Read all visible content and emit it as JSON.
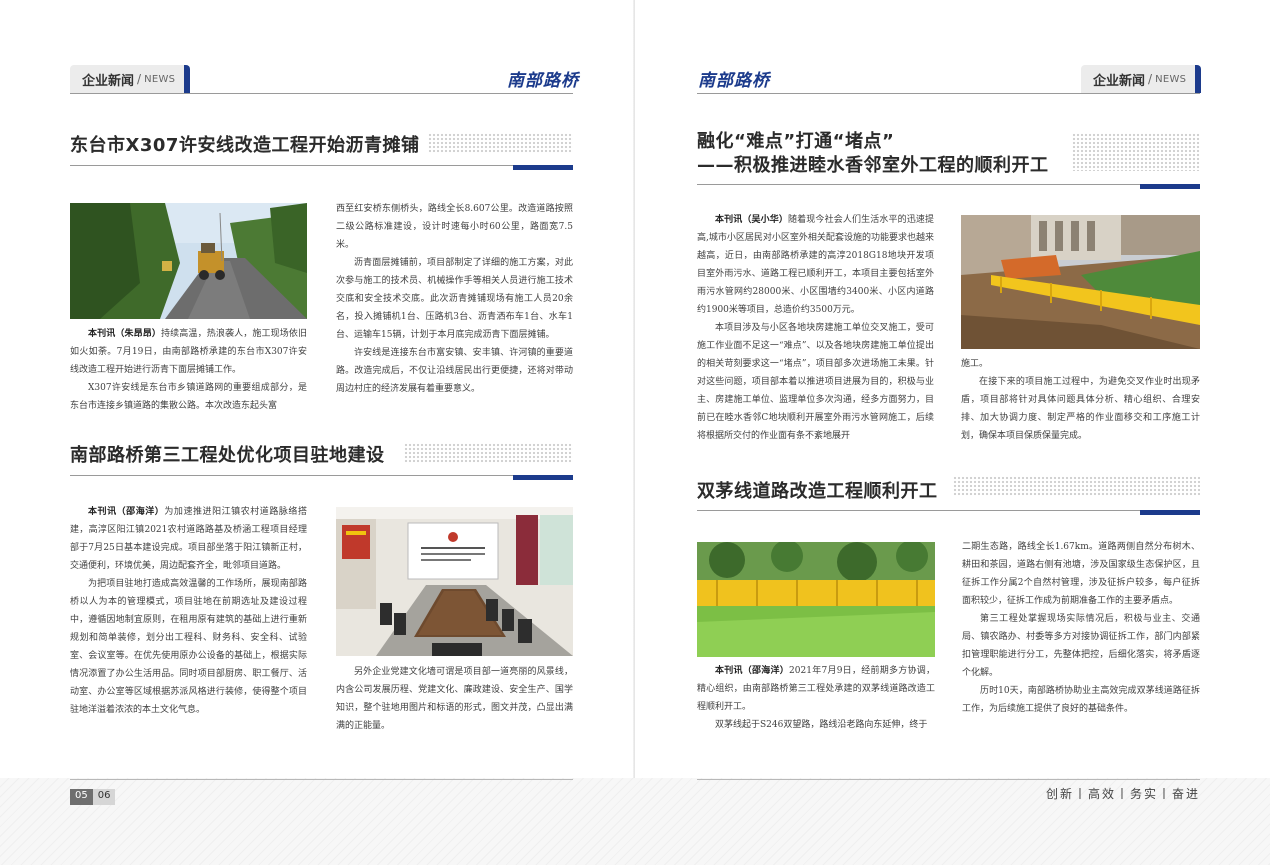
{
  "header": {
    "section_zh": "企业新闻",
    "section_sep": "/",
    "section_en": "NEWS",
    "brand": "南部路桥"
  },
  "left": {
    "article1": {
      "title": "东台市X307许安线改造工程开始沥青摊铺",
      "col1": [
        {
          "lead": "本刊讯（朱昂昂）",
          "text": "持续高温，热浪袭人，施工现场依旧如火如荼。7月19日，由南部路桥承建的东台市X307许安线改造工程开始进行沥青下面层摊铺工作。"
        },
        {
          "lead": "",
          "text": "X307许安线是东台市乡镇道路网的重要组成部分，是东台市连接乡镇道路的集散公路。本次改造东起头富"
        }
      ],
      "col2": [
        {
          "text": "西至红安桥东侧桥头，路线全长8.607公里。改造道路按照二级公路标准建设，设计时速每小时60公里，路面宽7.5米。"
        },
        {
          "text": "沥青面层摊铺前，项目部制定了详细的施工方案，对此次参与施工的技术员、机械操作手等相关人员进行施工技术交底和安全技术交底。此次沥青摊铺现场有施工人员20余名，投入摊铺机1台、压路机3台、沥青洒布车1台、水车1台、运输车15辆，计划于本月底完成沥青下面层摊铺。"
        },
        {
          "text": "许安线是连接东台市富安镇、安丰镇、许河镇的重要道路。改造完成后，不仅让沿线居民出行更便捷，还将对带动周边村庄的经济发展有着重要意义。"
        }
      ]
    },
    "article2": {
      "title": "南部路桥第三工程处优化项目驻地建设",
      "col1": [
        {
          "lead": "本刊讯（邵海洋）",
          "text": "为加速推进阳江镇农村道路脉络搭建，高淳区阳江镇2021农村道路路基及桥涵工程项目经理部于7月25日基本建设完成。项目部坐落于阳江镇新正村，交通便利，环境优美，周边配套齐全，毗邻项目道路。"
        },
        {
          "lead": "",
          "text": "为把项目驻地打造成高效温馨的工作场所，展现南部路桥以人为本的管理模式，项目驻地在前期选址及建设过程中，遵循因地制宜原则，在租用原有建筑的基础上进行重新规划和简单装修，划分出工程科、财务科、安全科、试验室、会议室等。在优先使用原办公设备的基础上，根据实际情况添置了办公生活用品。同时项目部厨房、职工餐厅、活动室、办公室等区域根据苏派风格进行装修，使得整个项目驻地洋溢着浓浓的本土文化气息。"
        }
      ],
      "col2": [
        {
          "text": "另外企业党建文化墙可谓是项目部一道亮丽的风景线，内含公司发展历程、党建文化、廉政建设、安全生产、国学知识，整个驻地用图片和标语的形式，图文并茂，凸显出满满的正能量。"
        }
      ]
    },
    "page_number": "05",
    "page_number_other": "06"
  },
  "right": {
    "article1": {
      "title_line1": "融化“难点”打通“堵点”",
      "title_line2": "——积极推进睦水香邻室外工程的顺利开工",
      "col1": [
        {
          "lead": "本刊讯（吴小华）",
          "text": "随着现今社会人们生活水平的迅速提高,城市小区居民对小区室外相关配套设施的功能要求也越来越高，近日，由南部路桥承建的高淳2018G18地块开发项目室外雨污水、道路工程已顺利开工，本项目主要包括室外雨污水管网约28000米、小区围墙约3400米、小区内道路约1900米等项目，总造价约3500万元。"
        },
        {
          "lead": "",
          "text": "本项目涉及与小区各地块房建施工单位交叉施工，受可施工作业面不足这一“难点”、以及各地块房建施工单位提出的相关苛刻要求这一“堵点”，项目部多次进场施工未果。针对这些问题，项目部本着以推进项目进展为目的，积极与业主、房建施工单位、监理单位多次沟通，经多方面努力，目前已在睦水香邻C地块顺利开展室外雨污水管网施工，后续将根据所交付的作业面有条不紊地展开"
        }
      ],
      "col2": [
        {
          "indent": false,
          "text": "施工。"
        },
        {
          "indent": true,
          "text": "在接下来的项目施工过程中，为避免交叉作业时出现矛盾，项目部将针对具体问题具体分析、精心组织、合理安排、加大协调力度、制定严格的作业面移交和工序施工计划，确保本项目保质保量完成。"
        }
      ]
    },
    "article2": {
      "title": "双茅线道路改造工程顺利开工",
      "col1": [
        {
          "lead": "本刊讯（邵海洋）",
          "text": "2021年7月9日，经前期多方协调，精心组织，由南部路桥第三工程处承建的双茅线道路改造工程顺利开工。"
        },
        {
          "lead": "",
          "text": "双茅线起于S246双望路，路线沿老路向东延伸，终于"
        }
      ],
      "col2": [
        {
          "indent": false,
          "text": "二期生态路，路线全长1.67km。道路两侧自然分布树木、耕田和茶园，道路右侧有池塘，涉及国家级生态保护区，且征拆工作分属2个自然村管理，涉及征拆户较多，每户征拆面积较少，征拆工作成为前期准备工作的主要矛盾点。"
        },
        {
          "indent": true,
          "text": "第三工程处掌握现场实际情况后，积极与业主、交通局、镇农路办、村委等多方对接协调征拆工作，部门内部紧扣管理职能进行分工，先整体把控，后细化落实，将矛盾逐个化解。"
        },
        {
          "indent": true,
          "text": "历时10天，南部路桥协助业主高效完成双茅线道路征拆工作，为后续施工提供了良好的基础条件。"
        }
      ]
    },
    "slogan": "创新丨高效丨务实丨奋进"
  },
  "colors": {
    "accent": "#1c3b8c",
    "rule": "#9a9a9a",
    "tab_bg": "#ececec"
  }
}
